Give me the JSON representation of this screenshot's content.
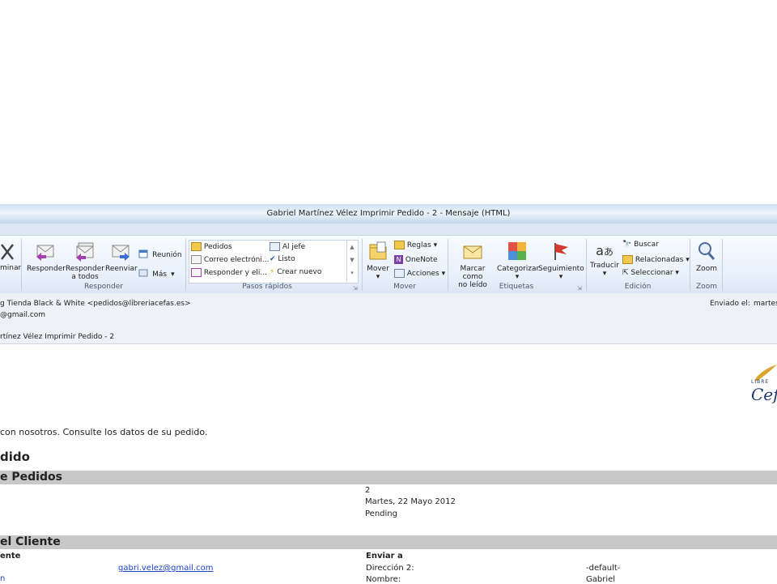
{
  "window": {
    "title": "Gabriel Martínez Vélez Imprimir Pedido - 2 - Mensaje (HTML)"
  },
  "ribbon": {
    "delete_label": "minar",
    "responder_group": {
      "reply": "Responder",
      "reply_all_1": "Responder",
      "reply_all_2": "a todos",
      "forward": "Reenviar",
      "meeting": "Reunión",
      "more": "Más",
      "label": "Responder"
    },
    "quick_steps": {
      "items": [
        "Pedidos",
        "Al jefe",
        "Correo electróni...",
        "Listo",
        "Responder y eli...",
        "Crear nuevo"
      ],
      "label": "Pasos rápidos"
    },
    "move_group": {
      "move": "Mover",
      "rules": "Reglas",
      "onenote": "OneNote",
      "actions": "Acciones",
      "label": "Mover"
    },
    "tags_group": {
      "mark_unread_1": "Marcar como",
      "mark_unread_2": "no leído",
      "categorize": "Categorizar",
      "followup": "Seguimiento",
      "label": "Etiquetas"
    },
    "edit_group": {
      "translate": "Traducir",
      "find": "Buscar",
      "related": "Relacionadas",
      "select": "Seleccionar",
      "label": "Edición"
    },
    "zoom_group": {
      "zoom": "Zoom",
      "label": "Zoom"
    }
  },
  "header": {
    "from": "g Tienda Black & White <pedidos@libreriacefas.es>",
    "to": "@gmail.com",
    "subject": "rtínez Vélez Imprimir Pedido - 2",
    "sent_label": "Enviado el:",
    "sent_value": "martes"
  },
  "body": {
    "logo_top": "LIBRE",
    "logo_text": "Cef",
    "intro": "con nosotros. Consulte los datos de su pedido.",
    "heading": "dido",
    "section_orders": "e Pedidos",
    "order_number": "2",
    "order_date": "Martes, 22 Mayo 2012",
    "order_status": "Pending",
    "section_client": "el Cliente",
    "client_label": "ente",
    "email": "gabri.velez@gmail.com",
    "ship_to_label": "Enviar a",
    "address2_label": "Dirección 2:",
    "address2_value": "-default-",
    "name_label": "Nombre:",
    "name_value": "Gabriel",
    "left_cut": "n"
  },
  "colors": {
    "ribbon_bg": "#e8f0fa",
    "band": "#c8c8c8",
    "link": "#1a3fc8"
  }
}
